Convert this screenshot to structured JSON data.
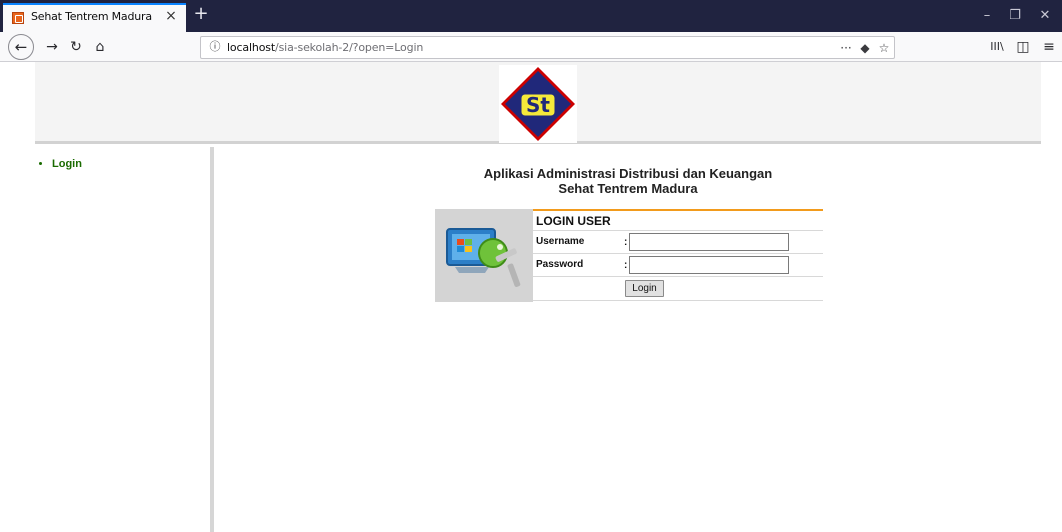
{
  "browser": {
    "tab_title": "Sehat Tentrem Madura",
    "tab_close": "×",
    "new_tab": "+",
    "url_info": "ⓘ",
    "url_host": "localhost",
    "url_path": "/sia-sekolah-2/?open=Login",
    "nav_back": "←",
    "nav_forward": "→",
    "nav_reload": "↻",
    "nav_home": "⌂",
    "url_more": "···",
    "url_pocket": "◆",
    "url_star": "☆",
    "library": "III\\",
    "sidebar_toggle": "◫",
    "menu": "≡",
    "win_min": "–",
    "win_restore": "❐",
    "win_close": "✕"
  },
  "logo": {
    "text": "St",
    "bg_color": "#20287a",
    "fill_color": "#f5e93a",
    "accent_color": "#cc0000"
  },
  "sidebar": {
    "items": [
      {
        "label": "Login"
      }
    ]
  },
  "page": {
    "title_line1": "Aplikasi Administrasi Distribusi dan Keuangan",
    "title_line2": "Sehat Tentrem Madura"
  },
  "login": {
    "heading": "LOGIN USER",
    "username_label": "Username",
    "password_label": "Password",
    "colon": ":",
    "username_value": "",
    "password_value": "",
    "submit_label": "Login"
  },
  "colors": {
    "tabbar": "#202340",
    "accent": "#f29b1c",
    "menu_link": "#1a6b00"
  }
}
